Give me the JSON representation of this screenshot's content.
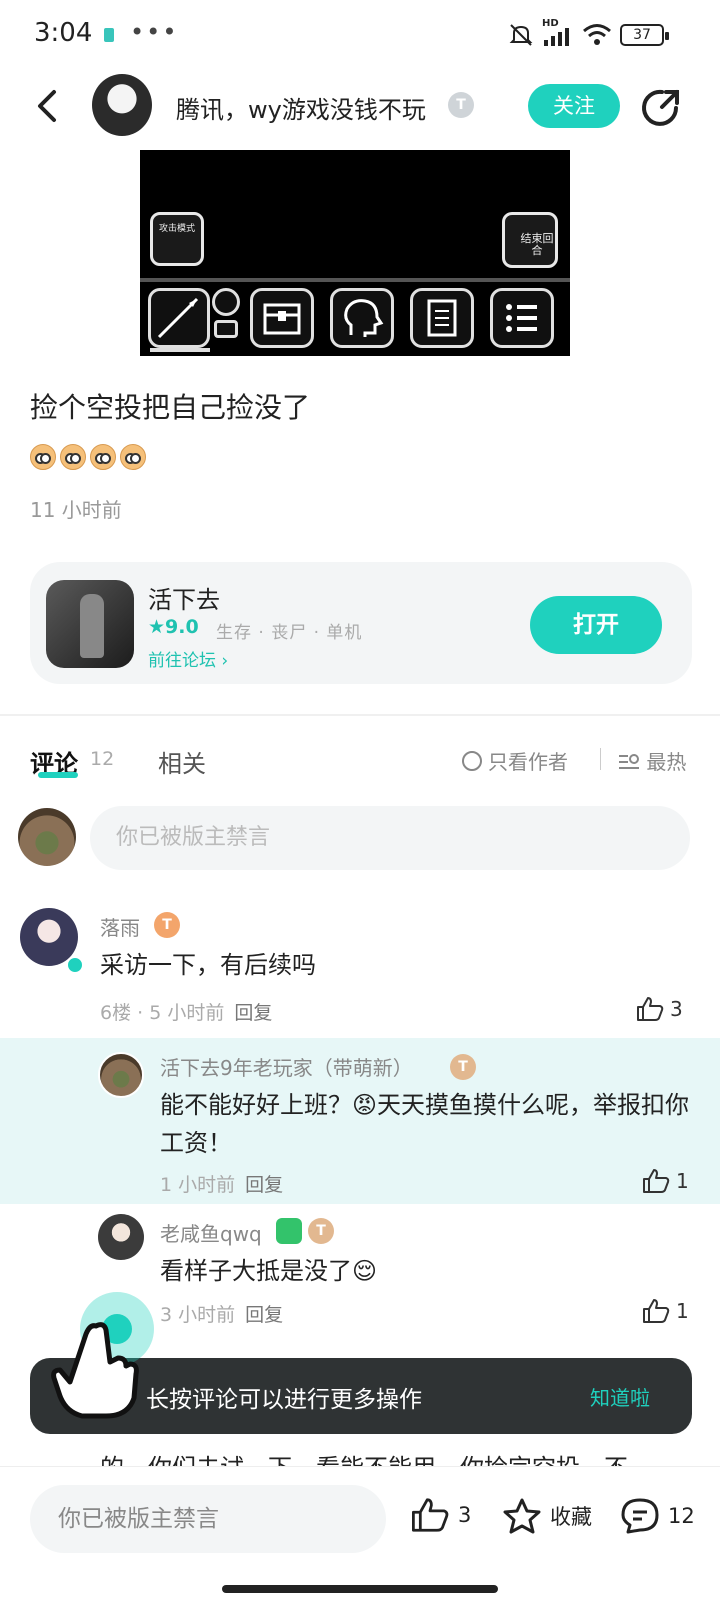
{
  "status_bar": {
    "time": "3:04",
    "dots": "•••",
    "battery": "37",
    "network": "HD"
  },
  "header": {
    "author_name": "腾讯，wy游戏没钱不玩",
    "author_level": "T",
    "follow_label": "关注"
  },
  "screenshot": {
    "attack_mode_label": "攻击模式",
    "end_turn_label": "结束回合"
  },
  "post": {
    "title": "捡个空投把自己捡没了",
    "time": "11 小时前"
  },
  "game_card": {
    "name": "活下去",
    "rating": "★9.0",
    "tags": "生存 · 丧尸 · 单机",
    "forum_link": "前往论坛 ›",
    "open_label": "打开"
  },
  "tabs": {
    "comments_label": "评论",
    "comments_count": "12",
    "related_label": "相关",
    "author_only_label": "只看作者",
    "sort_label": "最热"
  },
  "comment_input": {
    "placeholder": "你已被版主禁言"
  },
  "comments": [
    {
      "name": "落雨",
      "level": "T",
      "text": "采访一下，有后续吗",
      "meta": "6楼 · 5 小时前",
      "reply": "回复",
      "likes": "3"
    },
    {
      "name": "活下去9年老玩家（带萌新）",
      "level": "T",
      "text": "能不能好好上班？😡天天摸鱼摸什么呢，举报扣你工资！",
      "meta": "1 小时前",
      "reply": "回复",
      "likes": "1"
    },
    {
      "name": "老咸鱼qwq",
      "level": "T",
      "text": "看样子大抵是没了😌",
      "meta": "3 小时前",
      "reply": "回复",
      "likes": "1"
    }
  ],
  "cut_off_text": "的，你们去试一下，看能不能用，你捡完空投，不",
  "toast": {
    "message": "长按评论可以进行更多操作",
    "action": "知道啦"
  },
  "bottom_bar": {
    "input_placeholder": "你已被版主禁言",
    "like_count": "3",
    "favorite_label": "收藏",
    "comment_count": "12"
  },
  "colors": {
    "accent": "#1fd1be",
    "highlight_bg": "#e7f7f7",
    "toast_bg": "#2f3334"
  }
}
